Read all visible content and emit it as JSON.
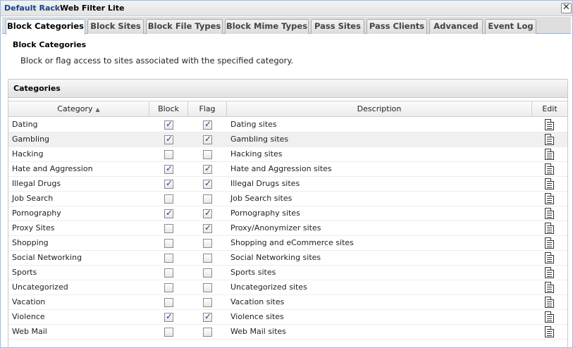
{
  "breadcrumb": {
    "root": "Default Rack",
    "separator": "▸",
    "current": "Web Filter Lite"
  },
  "close_symbol": "✕",
  "tabs": [
    {
      "label": "Block Categories",
      "active": true
    },
    {
      "label": "Block Sites"
    },
    {
      "label": "Block File Types"
    },
    {
      "label": "Block Mime Types"
    },
    {
      "label": "Pass Sites"
    },
    {
      "label": "Pass Clients"
    },
    {
      "label": "Advanced"
    },
    {
      "label": "Event Log"
    }
  ],
  "section": {
    "title": "Block Categories",
    "description": "Block or flag access to sites associated with the specified category."
  },
  "panel": {
    "title": "Categories"
  },
  "grid": {
    "columns": {
      "category": "Category",
      "block": "Block",
      "flag": "Flag",
      "description": "Description",
      "edit": "Edit"
    },
    "sort_indicator": "▲",
    "rows": [
      {
        "category": "Dating",
        "block": true,
        "flag": true,
        "description": "Dating sites"
      },
      {
        "category": "Gambling",
        "block": true,
        "flag": true,
        "description": "Gambling sites"
      },
      {
        "category": "Hacking",
        "block": false,
        "flag": false,
        "description": "Hacking sites"
      },
      {
        "category": "Hate and Aggression",
        "block": true,
        "flag": true,
        "description": "Hate and Aggression sites"
      },
      {
        "category": "Illegal Drugs",
        "block": true,
        "flag": true,
        "description": "Illegal Drugs sites"
      },
      {
        "category": "Job Search",
        "block": false,
        "flag": false,
        "description": "Job Search sites"
      },
      {
        "category": "Pornography",
        "block": true,
        "flag": true,
        "description": "Pornography sites"
      },
      {
        "category": "Proxy Sites",
        "block": false,
        "flag": true,
        "description": "Proxy/Anonymizer sites"
      },
      {
        "category": "Shopping",
        "block": false,
        "flag": false,
        "description": "Shopping and eCommerce sites"
      },
      {
        "category": "Social Networking",
        "block": false,
        "flag": false,
        "description": "Social Networking sites"
      },
      {
        "category": "Sports",
        "block": false,
        "flag": false,
        "description": "Sports sites"
      },
      {
        "category": "Uncategorized",
        "block": false,
        "flag": false,
        "description": "Uncategorized sites"
      },
      {
        "category": "Vacation",
        "block": false,
        "flag": false,
        "description": "Vacation sites"
      },
      {
        "category": "Violence",
        "block": true,
        "flag": true,
        "description": "Violence sites"
      },
      {
        "category": "Web Mail",
        "block": false,
        "flag": false,
        "description": "Web Mail sites"
      }
    ]
  }
}
